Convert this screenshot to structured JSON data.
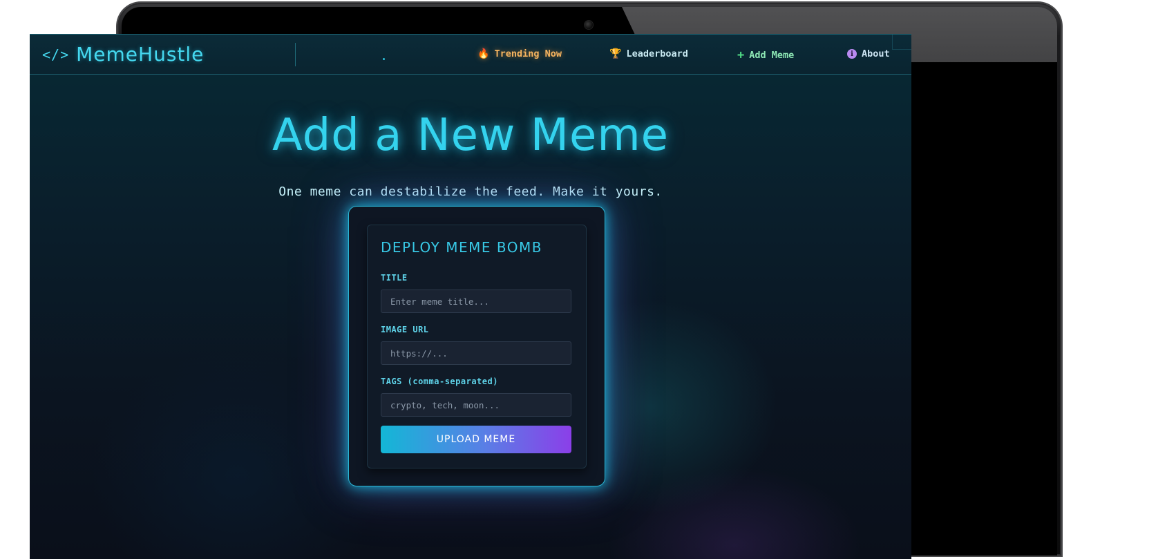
{
  "brand": {
    "icon": "</>",
    "name": "MemeHustle"
  },
  "nav": {
    "items": [
      {
        "label": "Trending Now",
        "icon": "flame-icon"
      },
      {
        "label": "Leaderboard",
        "icon": "trophy-icon"
      },
      {
        "label": "Add Meme",
        "icon": "plus-icon"
      },
      {
        "label": "About",
        "icon": "info-icon"
      }
    ]
  },
  "hero": {
    "title": "Add a New Meme",
    "subtitle": "One meme can destabilize the feed. Make it yours."
  },
  "form": {
    "heading": "DEPLOY MEME BOMB",
    "title_label": "TITLE",
    "title_placeholder": "Enter meme title...",
    "image_label": "IMAGE URL",
    "image_placeholder": "https://...",
    "tags_label": "TAGS (comma-separated)",
    "tags_placeholder": "crypto, tech, moon...",
    "submit_label": "UPLOAD MEME"
  },
  "colors": {
    "accent": "#34d3ee",
    "trending": "#f7b560",
    "add": "#4fdc86",
    "about": "#b98af0",
    "button_start": "#13b7d6",
    "button_end": "#8b3fe8"
  }
}
